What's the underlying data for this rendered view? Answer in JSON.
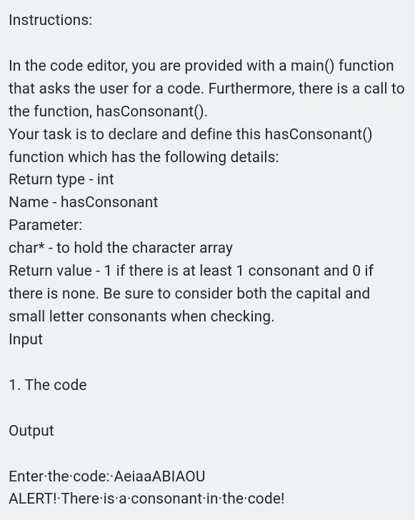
{
  "heading": "Instructions:",
  "p1": "In the code editor, you are provided with a main() function that asks the user for a code. Furthermore, there is a call to the function, hasConsonant().",
  "p2": "Your task is to declare and define this hasConsonant() function which has the following details:",
  "l1": "Return type - int",
  "l2": "Name - hasConsonant",
  "l3": "Parameter:",
  "l4": "char* - to hold the character array",
  "l5": "Return value - 1 if there is at least 1 consonant and 0 if there is none. Be sure to consider both the capital and small letter consonants when checking.",
  "inputHeading": "Input",
  "inputItem": "1. The code",
  "outputHeading": "Output",
  "out1": "Enter·the·code:·AeiaaABIAOU",
  "out2": "ALERT!·There·is·a·consonant·in·the·code!"
}
